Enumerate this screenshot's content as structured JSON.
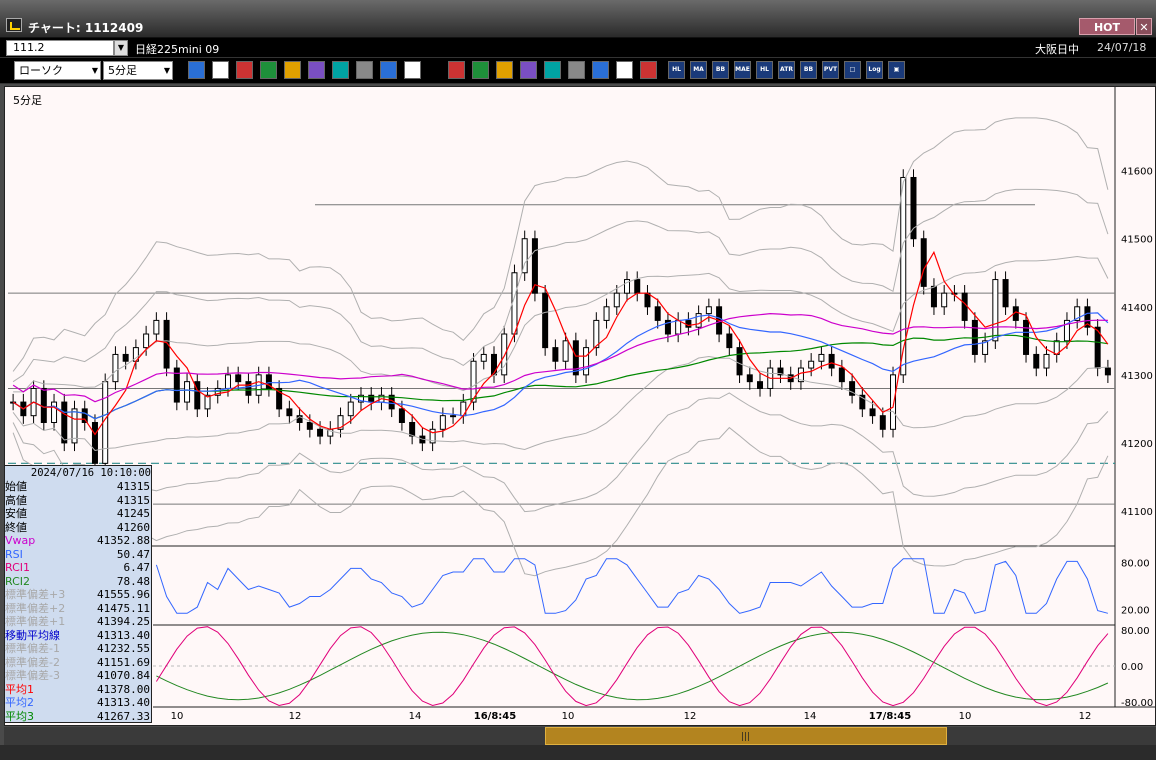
{
  "window": {
    "title": "チャート: 1112409",
    "hot_label": "HOT",
    "close_label": "✕"
  },
  "symbol": {
    "code": "111.2",
    "name": "日経225mini 09",
    "market_state": "大阪日中",
    "date": "24/07/18"
  },
  "toolbar": {
    "chart_type": "ローソク",
    "timeframe": "5分足",
    "icons": [
      "zoom-icon",
      "split-icon",
      "marker-icon",
      "search-zoom-icon",
      "price-icon",
      "expand-icon",
      "info-icon",
      "adjust-icon",
      "adjust2-icon",
      "all-icon",
      "pen-icon",
      "line-icon",
      "pointer-icon",
      "undo-icon",
      "memo-icon",
      "trash-icon",
      "grid-icon",
      "settings-icon",
      "color-icon"
    ],
    "indicator_buttons": [
      "HL",
      "MA",
      "BB",
      "MAE",
      "HL",
      "ATR",
      "BB",
      "PVT",
      "□",
      "Log",
      "▣"
    ]
  },
  "chart": {
    "label": "5分足",
    "price_ticks": [
      "41600",
      "41500",
      "41400",
      "41300",
      "41200",
      "41100"
    ],
    "rsi_ticks": [
      "80.00",
      "20.00"
    ],
    "rci_ticks": [
      "80.00",
      "0.00",
      "-80.00"
    ],
    "time_ticks": [
      "10",
      "12",
      "14",
      "16/8:45",
      "10",
      "12",
      "14",
      "17/8:45",
      "10",
      "12"
    ],
    "colors": {
      "candle": "#000000",
      "vwap": "#cc00cc",
      "ma": "#0000cc",
      "ma1": "#ff0000",
      "ma2": "#3366ff",
      "ma3": "#008800",
      "bb": "#b0b0b0",
      "rsi": "#3366ff",
      "rci1": "#e0007a",
      "rci2": "#228822"
    }
  },
  "datapanel": {
    "time": "2024/07/16  10:10:00",
    "rows": [
      {
        "label": "始値",
        "value": "41315",
        "color": "#000000"
      },
      {
        "label": "高値",
        "value": "41315",
        "color": "#000000"
      },
      {
        "label": "安値",
        "value": "41245",
        "color": "#000000"
      },
      {
        "label": "終値",
        "value": "41260",
        "color": "#000000"
      },
      {
        "label": "Vwap",
        "value": "41352.88",
        "color": "#cc00cc"
      },
      {
        "label": "RSI",
        "value": "50.47",
        "color": "#3366ff"
      },
      {
        "label": "RCI1",
        "value": "6.47",
        "color": "#e0007a"
      },
      {
        "label": "RCI2",
        "value": "78.48",
        "color": "#228822"
      },
      {
        "label": "標準偏差+3",
        "value": "41555.96",
        "color": "#a8a8a8"
      },
      {
        "label": "標準偏差+2",
        "value": "41475.11",
        "color": "#a8a8a8"
      },
      {
        "label": "標準偏差+1",
        "value": "41394.25",
        "color": "#a8a8a8"
      },
      {
        "label": "移動平均線",
        "value": "41313.40",
        "color": "#0000cc"
      },
      {
        "label": "標準偏差-1",
        "value": "41232.55",
        "color": "#a8a8a8"
      },
      {
        "label": "標準偏差-2",
        "value": "41151.69",
        "color": "#a8a8a8"
      },
      {
        "label": "標準偏差-3",
        "value": "41070.84",
        "color": "#a8a8a8"
      },
      {
        "label": "平均1",
        "value": "41378.00",
        "color": "#ff0000"
      },
      {
        "label": "平均2",
        "value": "41313.40",
        "color": "#3366ff"
      },
      {
        "label": "平均3",
        "value": "41267.33",
        "color": "#008800"
      }
    ]
  },
  "chart_data": {
    "type": "candlestick",
    "title": "5分足",
    "ylim": [
      41050,
      41720
    ],
    "levels": {
      "hlines": [
        41550,
        41420,
        41280,
        41110
      ],
      "dashed": 41170
    },
    "closes": [
      41260,
      41240,
      41280,
      41230,
      41260,
      41200,
      41250,
      41230,
      41170,
      41290,
      41330,
      41320,
      41340,
      41360,
      41380,
      41310,
      41260,
      41290,
      41250,
      41270,
      41280,
      41300,
      41290,
      41270,
      41300,
      41280,
      41250,
      41240,
      41230,
      41220,
      41210,
      41220,
      41240,
      41260,
      41270,
      41260,
      41270,
      41250,
      41230,
      41210,
      41200,
      41220,
      41240,
      41240,
      41260,
      41320,
      41330,
      41300,
      41360,
      41450,
      41500,
      41420,
      41340,
      41320,
      41350,
      41300,
      41340,
      41380,
      41400,
      41420,
      41440,
      41420,
      41400,
      41380,
      41360,
      41380,
      41370,
      41390,
      41400,
      41360,
      41340,
      41300,
      41290,
      41280,
      41310,
      41300,
      41290,
      41310,
      41320,
      41330,
      41310,
      41290,
      41270,
      41250,
      41240,
      41220,
      41300,
      41590,
      41500,
      41430,
      41400,
      41420,
      41420,
      41380,
      41330,
      41350,
      41440,
      41400,
      41380,
      41330,
      41310,
      41330,
      41350,
      41380,
      41400,
      41370,
      41310,
      41300
    ]
  }
}
